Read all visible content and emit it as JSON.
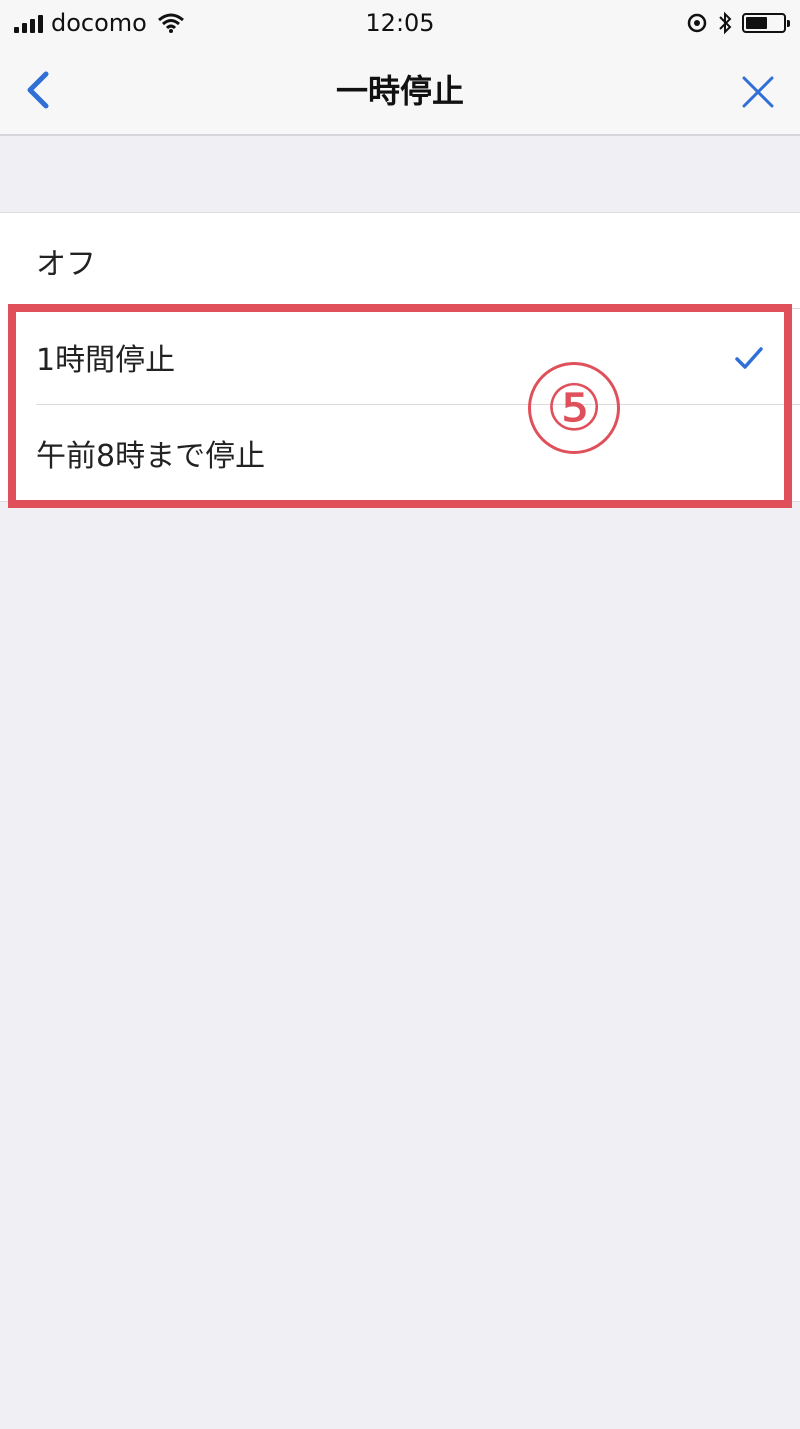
{
  "status_bar": {
    "carrier": "docomo",
    "time": "12:05",
    "icons": [
      "signal-icon",
      "wifi-icon",
      "location-icon",
      "bluetooth-icon",
      "battery-icon"
    ],
    "battery_level": 0.52
  },
  "nav": {
    "title": "一時停止",
    "back_icon": "chevron-left-icon",
    "close_icon": "close-icon"
  },
  "options": [
    {
      "label": "オフ",
      "selected": false
    },
    {
      "label": "1時間停止",
      "selected": true
    },
    {
      "label": "午前8時まで停止",
      "selected": false
    }
  ],
  "annotation": {
    "number": "⑤",
    "color": "#e0505a"
  },
  "colors": {
    "accent": "#2f6fd6",
    "background": "#efeff4"
  }
}
